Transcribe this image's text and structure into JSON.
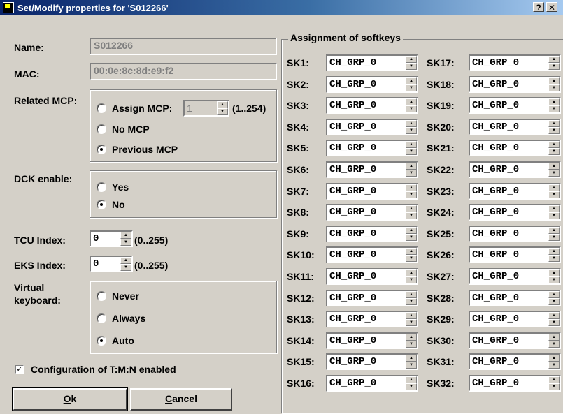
{
  "window": {
    "title": "Set/Modify properties for 'S012266'",
    "help_btn": "?",
    "close_btn": "✕"
  },
  "name": {
    "label": "Name:",
    "value": "S012266"
  },
  "mac": {
    "label": "MAC:",
    "value": "00:0e:8c:8d:e9:f2"
  },
  "related_mcp": {
    "label": "Related MCP:",
    "assign_label": "Assign MCP:",
    "assign_value": "1",
    "assign_range": "(1..254)",
    "no_mcp_label": "No MCP",
    "previous_label": "Previous MCP",
    "selected": "Previous MCP"
  },
  "dck": {
    "label": "DCK enable:",
    "yes": "Yes",
    "no": "No",
    "selected": "No"
  },
  "tcu": {
    "label": "TCU Index:",
    "value": "0",
    "range": "(0..255)"
  },
  "eks": {
    "label": "EKS Index:",
    "value": "0",
    "range": "(0..255)"
  },
  "virtual_keyboard": {
    "label_line1": "Virtual",
    "label_line2": "keyboard:",
    "never": "Never",
    "always": "Always",
    "auto": "Auto",
    "selected": "Auto"
  },
  "tmn": {
    "label": "Configuration of T:M:N enabled",
    "checked": true
  },
  "buttons": {
    "ok_u": "O",
    "ok_rest": "k",
    "cancel_u": "C",
    "cancel_rest": "ancel"
  },
  "softkeys": {
    "title": "Assignment of softkeys",
    "left": [
      {
        "label": "SK1:",
        "value": "CH_GRP_0"
      },
      {
        "label": "SK2:",
        "value": "CH_GRP_0"
      },
      {
        "label": "SK3:",
        "value": "CH_GRP_0"
      },
      {
        "label": "SK4:",
        "value": "CH_GRP_0"
      },
      {
        "label": "SK5:",
        "value": "CH_GRP_0"
      },
      {
        "label": "SK6:",
        "value": "CH_GRP_0"
      },
      {
        "label": "SK7:",
        "value": "CH_GRP_0"
      },
      {
        "label": "SK8:",
        "value": "CH_GRP_0"
      },
      {
        "label": "SK9:",
        "value": "CH_GRP_0"
      },
      {
        "label": "SK10:",
        "value": "CH_GRP_0"
      },
      {
        "label": "SK11:",
        "value": "CH_GRP_0"
      },
      {
        "label": "SK12:",
        "value": "CH_GRP_0"
      },
      {
        "label": "SK13:",
        "value": "CH_GRP_0"
      },
      {
        "label": "SK14:",
        "value": "CH_GRP_0"
      },
      {
        "label": "SK15:",
        "value": "CH_GRP_0"
      },
      {
        "label": "SK16:",
        "value": "CH_GRP_0"
      }
    ],
    "right": [
      {
        "label": "SK17:",
        "value": "CH_GRP_0"
      },
      {
        "label": "SK18:",
        "value": "CH_GRP_0"
      },
      {
        "label": "SK19:",
        "value": "CH_GRP_0"
      },
      {
        "label": "SK20:",
        "value": "CH_GRP_0"
      },
      {
        "label": "SK21:",
        "value": "CH_GRP_0"
      },
      {
        "label": "SK22:",
        "value": "CH_GRP_0"
      },
      {
        "label": "SK23:",
        "value": "CH_GRP_0"
      },
      {
        "label": "SK24:",
        "value": "CH_GRP_0"
      },
      {
        "label": "SK25:",
        "value": "CH_GRP_0"
      },
      {
        "label": "SK26:",
        "value": "CH_GRP_0"
      },
      {
        "label": "SK27:",
        "value": "CH_GRP_0"
      },
      {
        "label": "SK28:",
        "value": "CH_GRP_0"
      },
      {
        "label": "SK29:",
        "value": "CH_GRP_0"
      },
      {
        "label": "SK30:",
        "value": "CH_GRP_0"
      },
      {
        "label": "SK31:",
        "value": "CH_GRP_0"
      },
      {
        "label": "SK32:",
        "value": "CH_GRP_0"
      }
    ]
  },
  "colors": {
    "title_bar": "#0a246a",
    "dialog_face": "#d4d0c8"
  }
}
